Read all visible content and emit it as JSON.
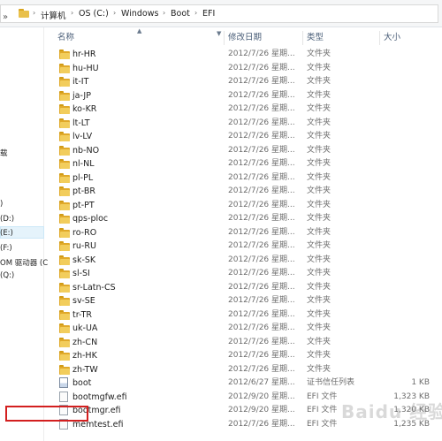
{
  "address": {
    "crumbs": [
      "计算机",
      "OS (C:)",
      "Windows",
      "Boot",
      "EFI"
    ],
    "separator": "›",
    "up": "»"
  },
  "nav": {
    "items": [
      "载",
      ")",
      "(D:)",
      "(E:)",
      "(F:)",
      "OM 驱动器 (C",
      "(Q:)"
    ]
  },
  "columns": {
    "name": "名称",
    "date": "修改日期",
    "type": "类型",
    "size": "大小"
  },
  "files": [
    {
      "name": "hr-HR",
      "date": "2012/7/26 星期...",
      "type": "文件夹",
      "size": "",
      "icon": "folder-icon"
    },
    {
      "name": "hu-HU",
      "date": "2012/7/26 星期...",
      "type": "文件夹",
      "size": "",
      "icon": "folder-icon"
    },
    {
      "name": "it-IT",
      "date": "2012/7/26 星期...",
      "type": "文件夹",
      "size": "",
      "icon": "folder-icon"
    },
    {
      "name": "ja-JP",
      "date": "2012/7/26 星期...",
      "type": "文件夹",
      "size": "",
      "icon": "folder-icon"
    },
    {
      "name": "ko-KR",
      "date": "2012/7/26 星期...",
      "type": "文件夹",
      "size": "",
      "icon": "folder-icon"
    },
    {
      "name": "lt-LT",
      "date": "2012/7/26 星期...",
      "type": "文件夹",
      "size": "",
      "icon": "folder-icon"
    },
    {
      "name": "lv-LV",
      "date": "2012/7/26 星期...",
      "type": "文件夹",
      "size": "",
      "icon": "folder-icon"
    },
    {
      "name": "nb-NO",
      "date": "2012/7/26 星期...",
      "type": "文件夹",
      "size": "",
      "icon": "folder-icon"
    },
    {
      "name": "nl-NL",
      "date": "2012/7/26 星期...",
      "type": "文件夹",
      "size": "",
      "icon": "folder-icon"
    },
    {
      "name": "pl-PL",
      "date": "2012/7/26 星期...",
      "type": "文件夹",
      "size": "",
      "icon": "folder-icon"
    },
    {
      "name": "pt-BR",
      "date": "2012/7/26 星期...",
      "type": "文件夹",
      "size": "",
      "icon": "folder-icon"
    },
    {
      "name": "pt-PT",
      "date": "2012/7/26 星期...",
      "type": "文件夹",
      "size": "",
      "icon": "folder-icon"
    },
    {
      "name": "qps-ploc",
      "date": "2012/7/26 星期...",
      "type": "文件夹",
      "size": "",
      "icon": "folder-icon"
    },
    {
      "name": "ro-RO",
      "date": "2012/7/26 星期...",
      "type": "文件夹",
      "size": "",
      "icon": "folder-icon"
    },
    {
      "name": "ru-RU",
      "date": "2012/7/26 星期...",
      "type": "文件夹",
      "size": "",
      "icon": "folder-icon"
    },
    {
      "name": "sk-SK",
      "date": "2012/7/26 星期...",
      "type": "文件夹",
      "size": "",
      "icon": "folder-icon"
    },
    {
      "name": "sl-SI",
      "date": "2012/7/26 星期...",
      "type": "文件夹",
      "size": "",
      "icon": "folder-icon"
    },
    {
      "name": "sr-Latn-CS",
      "date": "2012/7/26 星期...",
      "type": "文件夹",
      "size": "",
      "icon": "folder-icon"
    },
    {
      "name": "sv-SE",
      "date": "2012/7/26 星期...",
      "type": "文件夹",
      "size": "",
      "icon": "folder-icon"
    },
    {
      "name": "tr-TR",
      "date": "2012/7/26 星期...",
      "type": "文件夹",
      "size": "",
      "icon": "folder-icon"
    },
    {
      "name": "uk-UA",
      "date": "2012/7/26 星期...",
      "type": "文件夹",
      "size": "",
      "icon": "folder-icon"
    },
    {
      "name": "zh-CN",
      "date": "2012/7/26 星期...",
      "type": "文件夹",
      "size": "",
      "icon": "folder-icon"
    },
    {
      "name": "zh-HK",
      "date": "2012/7/26 星期...",
      "type": "文件夹",
      "size": "",
      "icon": "folder-icon"
    },
    {
      "name": "zh-TW",
      "date": "2012/7/26 星期...",
      "type": "文件夹",
      "size": "",
      "icon": "folder-icon"
    },
    {
      "name": "boot",
      "date": "2012/6/27 星期...",
      "type": "证书信任列表",
      "size": "1 KB",
      "icon": "certificate-icon"
    },
    {
      "name": "bootmgfw.efi",
      "date": "2012/9/20 星期...",
      "type": "EFI 文件",
      "size": "1,323 KB",
      "icon": "file-icon"
    },
    {
      "name": "bootmgr.efi",
      "date": "2012/9/20 星期...",
      "type": "EFI 文件",
      "size": "1,320 KB",
      "icon": "file-icon"
    },
    {
      "name": "memtest.efi",
      "date": "2012/7/26 星期...",
      "type": "EFI 文件",
      "size": "1,235 KB",
      "icon": "file-icon"
    }
  ],
  "watermark": "Baidu 经验",
  "colors": {
    "highlight_box": "#d31f1f",
    "folder": "#e0a92a"
  }
}
